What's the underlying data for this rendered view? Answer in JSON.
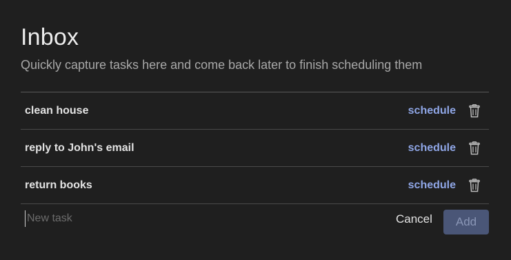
{
  "header": {
    "title": "Inbox",
    "subtitle": "Quickly capture tasks here and come back later to finish scheduling them"
  },
  "tasks": [
    {
      "text": "clean house",
      "action_label": "schedule",
      "delete_icon": "trash-icon"
    },
    {
      "text": "reply to John's email",
      "action_label": "schedule",
      "delete_icon": "trash-icon"
    },
    {
      "text": "return books",
      "action_label": "schedule",
      "delete_icon": "trash-icon"
    }
  ],
  "new_task": {
    "value": "",
    "placeholder": "New task",
    "cancel_label": "Cancel",
    "add_label": "Add"
  },
  "colors": {
    "background": "#1f1f1f",
    "link": "#8fa6e6",
    "add_button": "#4a5677"
  }
}
